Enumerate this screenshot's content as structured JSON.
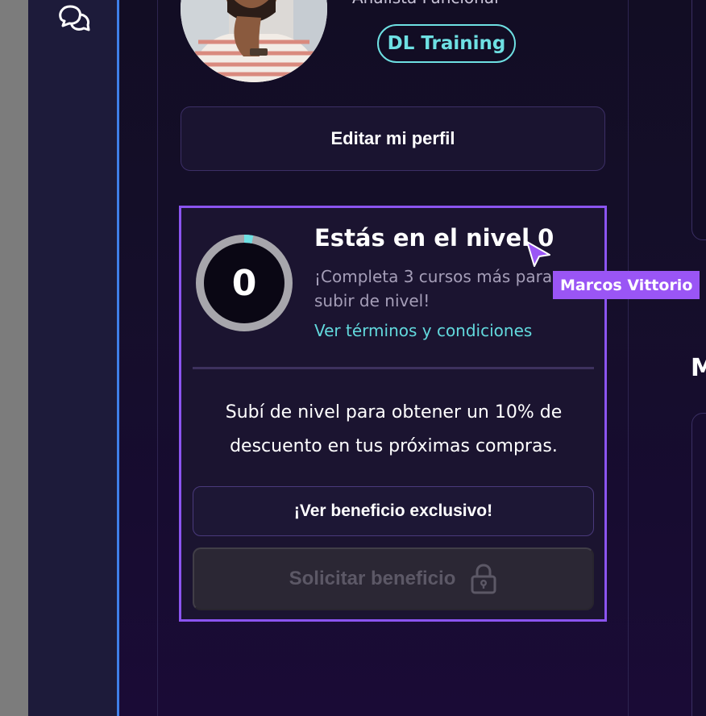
{
  "profile": {
    "role": "Analista Funcional",
    "company_badge": "DL Training",
    "edit_button": "Editar mi perfil"
  },
  "level_card": {
    "level_number": "0",
    "title": "Estás en el nivel 0",
    "description": "¡Completa 3 cursos más para subir de nivel!",
    "progress_fraction": 0.03,
    "terms_link": "Ver términos y condiciones",
    "benefit_text": "Subí de nivel para obtener un 10% de descuento en tus próximas compras.",
    "exclusive_button": "¡Ver beneficio exclusivo!",
    "request_button": "Solicitar beneficio"
  },
  "collaborator": {
    "name": "Marcos Vittorio",
    "color": "#9a55f5"
  },
  "right_panel": {
    "heading_letter": "M"
  },
  "colors": {
    "accent_cyan": "#6ee0e3",
    "accent_purple": "#8b54f0",
    "sidebar_divider": "#3f7fe8"
  },
  "icons": {
    "sidebar": "chat-bubbles-icon",
    "lock": "lock-icon",
    "cursor": "cursor-pointer-icon"
  }
}
